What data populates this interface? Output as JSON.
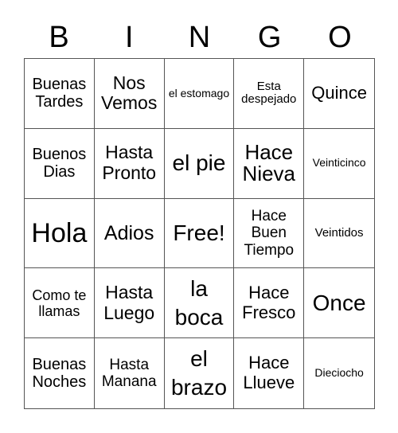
{
  "header": [
    "B",
    "I",
    "N",
    "G",
    "O"
  ],
  "cells": [
    "Buenas Tardes",
    "Nos Vemos",
    "el estomago",
    "Esta despejado",
    "Quince",
    "Buenos Dias",
    "Hasta Pronto",
    "el pie",
    "Hace Nieva",
    "Veinticinco",
    "Hola",
    "Adios",
    "Free!",
    "Hace Buen Tiempo",
    "Veintidos",
    "Como te llamas",
    "Hasta Luego",
    "la boca",
    "Hace Fresco",
    "Once",
    "Buenas Noches",
    "Hasta Manana",
    "el brazo",
    "Hace Llueve",
    "Dieciocho"
  ],
  "free_space": "Free!"
}
